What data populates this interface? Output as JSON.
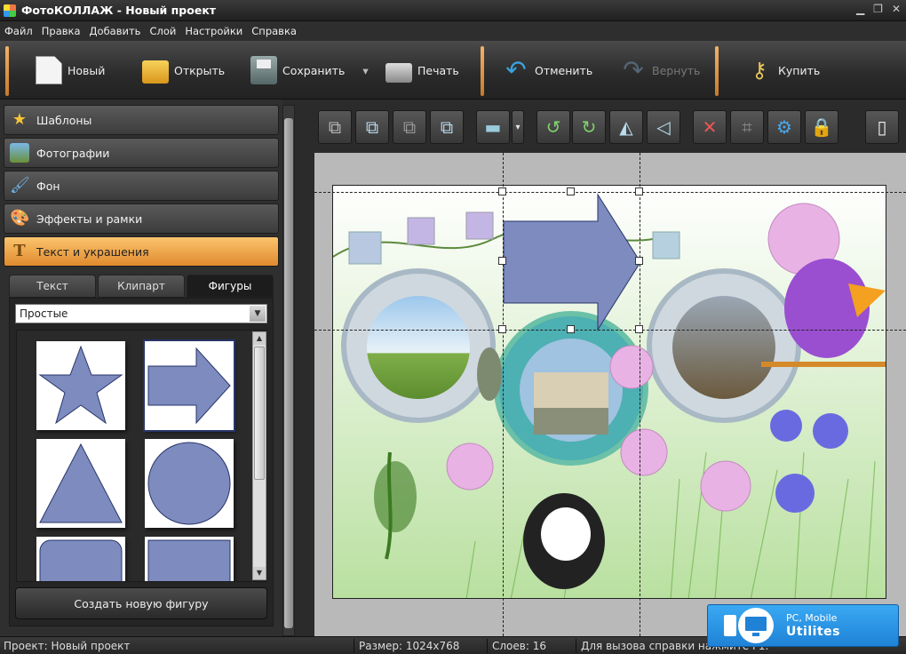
{
  "titlebar": {
    "title": "ФотоКОЛЛАЖ - Новый проект"
  },
  "menu": [
    "Файл",
    "Правка",
    "Добавить",
    "Слой",
    "Настройки",
    "Справка"
  ],
  "toolbar": {
    "new": "Новый",
    "open": "Открыть",
    "save": "Сохранить",
    "print": "Печать",
    "undo": "Отменить",
    "redo": "Вернуть",
    "buy": "Купить"
  },
  "sidebar": {
    "items": [
      "Шаблоны",
      "Фотографии",
      "Фон",
      "Эффекты и рамки",
      "Текст и украшения"
    ],
    "active_index": 4
  },
  "tabs": [
    "Текст",
    "Клипарт",
    "Фигуры"
  ],
  "active_tab": "Фигуры",
  "shape_filter": {
    "selected": "Простые"
  },
  "shapes": [
    "star",
    "arrow",
    "triangle",
    "circle",
    "rounded-rect",
    "rect"
  ],
  "create_shape_button": "Создать новую фигуру",
  "canvas_tools": [
    "bring-front",
    "send-back",
    "forward",
    "backward",
    "align",
    "rotate-left",
    "rotate-right",
    "flip-horizontal",
    "flip-vertical",
    "delete",
    "crop",
    "settings",
    "lock",
    "page"
  ],
  "status": {
    "project": "Проект: Новый проект",
    "size": "Размер: 1024x768",
    "layers": "Слоев: 16",
    "help": "Для вызова справки нажмите F1."
  },
  "badge": {
    "line1": "PC, Mobile",
    "line2": "Utilites"
  },
  "colors": {
    "accent_orange": "#f3a64a",
    "shape_fill": "#7e8bbf",
    "shape_stroke": "#27356a",
    "badge_blue": "#2a93e4"
  }
}
